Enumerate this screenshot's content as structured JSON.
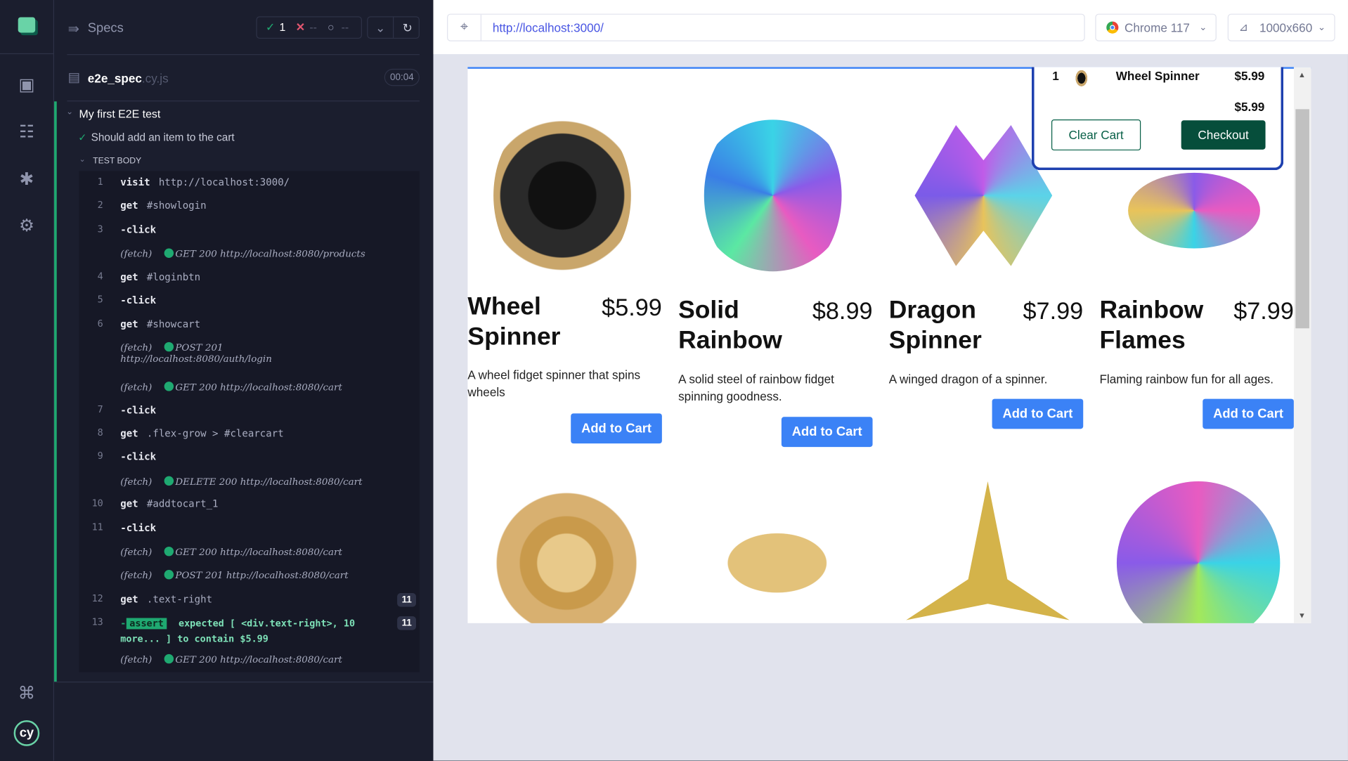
{
  "sidebar": {
    "icons": [
      "cypress-app-logo",
      "specs-icon",
      "runs-icon",
      "debug-icon",
      "settings-icon",
      "keyboard-shortcuts-icon",
      "cypress-logo"
    ]
  },
  "header": {
    "title": "Specs",
    "passed": "1",
    "failed": "--",
    "pending": "--"
  },
  "spec": {
    "name": "e2e_spec",
    "ext": ".cy.js",
    "duration": "00:04"
  },
  "suite": {
    "title": "My first E2E test",
    "test": "Should add an item to the cart",
    "section": "TEST BODY"
  },
  "commands": [
    {
      "n": "1",
      "name": "visit",
      "arg": "http://localhost:3000/"
    },
    {
      "n": "2",
      "name": "get",
      "arg": "#showlogin"
    },
    {
      "n": "3",
      "name": "-click",
      "arg": ""
    },
    {
      "fetch": "(fetch)",
      "req": "GET 200 http://localhost:8080/products"
    },
    {
      "n": "4",
      "name": "get",
      "arg": "#loginbtn"
    },
    {
      "n": "5",
      "name": "-click",
      "arg": ""
    },
    {
      "n": "6",
      "name": "get",
      "arg": "#showcart"
    },
    {
      "fetch": "(fetch)",
      "req": "POST 201",
      "req2": "http://localhost:8080/auth/login"
    },
    {
      "fetch": "(fetch)",
      "req": "GET 200 http://localhost:8080/cart"
    },
    {
      "n": "7",
      "name": "-click",
      "arg": ""
    },
    {
      "n": "8",
      "name": "get",
      "arg": ".flex-grow > #clearcart"
    },
    {
      "n": "9",
      "name": "-click",
      "arg": ""
    },
    {
      "fetch": "(fetch)",
      "req": "DELETE 200 http://localhost:8080/cart"
    },
    {
      "n": "10",
      "name": "get",
      "arg": "#addtocart_1"
    },
    {
      "n": "11",
      "name": "-click",
      "arg": ""
    },
    {
      "fetch": "(fetch)",
      "req": "GET 200 http://localhost:8080/cart"
    },
    {
      "fetch": "(fetch)",
      "req": "POST 201 http://localhost:8080/cart"
    },
    {
      "n": "12",
      "name": "get",
      "arg": ".text-right",
      "badge": "11"
    },
    {
      "n": "13",
      "name": "-",
      "assert": "assert",
      "msg1": "expected [ <div.text-right>, 10",
      "msg2": "more... ] to contain $5.99",
      "badge": "11"
    },
    {
      "fetch": "(fetch)",
      "req": "GET 200 http://localhost:8080/cart"
    }
  ],
  "browser": {
    "url": "http://localhost:3000/",
    "browser": "Chrome 117",
    "viewport": "1000x660"
  },
  "cart": {
    "qty": "1",
    "item": "Wheel Spinner",
    "price": "$5.99",
    "total": "$5.99",
    "clear": "Clear Cart",
    "checkout": "Checkout"
  },
  "products": [
    {
      "title": "Wheel Spinner",
      "price": "$5.99",
      "desc": "A wheel fidget spinner that spins wheels",
      "button": "Add to Cart"
    },
    {
      "title": "Solid Rainbow",
      "price": "$8.99",
      "desc": "A solid steel of rainbow fidget spinning goodness.",
      "button": "Add to Cart"
    },
    {
      "title": "Dragon Spinner",
      "price": "$7.99",
      "desc": "A winged dragon of a spinner.",
      "button": "Add to Cart"
    },
    {
      "title": "Rainbow Flames",
      "price": "$7.99",
      "desc": "Flaming rainbow fun for all ages.",
      "button": "Add to Cart"
    }
  ],
  "colors": {
    "accent": "#3b82f6",
    "pass": "#1fa971",
    "fail": "#e45770",
    "checkout": "#064e3b",
    "cart_border": "#1e40af"
  }
}
